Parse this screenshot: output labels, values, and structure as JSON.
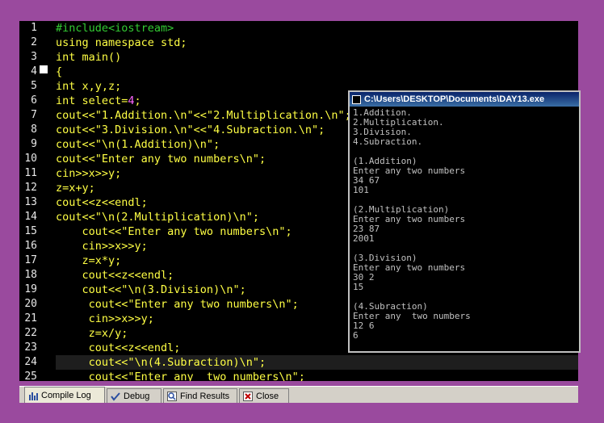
{
  "editor": {
    "line_numbers": [
      "1",
      "2",
      "3",
      "4",
      "5",
      "6",
      "7",
      "8",
      "9",
      "10",
      "11",
      "12",
      "13",
      "14",
      "15",
      "16",
      "17",
      "18",
      "19",
      "20",
      "21",
      "22",
      "23",
      "24",
      "25"
    ],
    "lines": [
      [
        {
          "t": "#include<iostream>",
          "c": "pp"
        }
      ],
      [
        {
          "t": "using namespace std;",
          "c": "kw"
        }
      ],
      [
        {
          "t": "int main()",
          "c": "kw"
        }
      ],
      [
        {
          "t": "{",
          "c": "kw"
        }
      ],
      [
        {
          "t": "int x,y,z;",
          "c": "kw"
        }
      ],
      [
        {
          "t": "int select=",
          "c": "kw"
        },
        {
          "t": "4",
          "c": "num"
        },
        {
          "t": ";",
          "c": "kw"
        }
      ],
      [
        {
          "t": "cout<<\"1.Addition.\\n\"<<\"2.Multiplication.\\n\";",
          "c": "kw"
        }
      ],
      [
        {
          "t": "cout<<\"3.Division.\\n\"<<\"4.Subraction.\\n\";",
          "c": "kw"
        }
      ],
      [
        {
          "t": "cout<<\"\\n(1.Addition)\\n\";",
          "c": "kw"
        }
      ],
      [
        {
          "t": "cout<<\"Enter any two numbers\\n\";",
          "c": "kw"
        }
      ],
      [
        {
          "t": "cin>>x>>y;",
          "c": "kw"
        }
      ],
      [
        {
          "t": "z=x+y;",
          "c": "kw"
        }
      ],
      [
        {
          "t": "cout<<z<<endl;",
          "c": "kw"
        }
      ],
      [
        {
          "t": "cout<<\"\\n(2.Multiplication)\\n\";",
          "c": "kw"
        }
      ],
      [
        {
          "t": "    cout<<\"Enter any two numbers\\n\";",
          "c": "kw"
        }
      ],
      [
        {
          "t": "    cin>>x>>y;",
          "c": "kw"
        }
      ],
      [
        {
          "t": "    z=x*y;",
          "c": "kw"
        }
      ],
      [
        {
          "t": "    cout<<z<<endl;",
          "c": "kw"
        }
      ],
      [
        {
          "t": "    cout<<\"\\n(3.Division)\\n\";",
          "c": "kw"
        }
      ],
      [
        {
          "t": "     cout<<\"Enter any two numbers\\n\";",
          "c": "kw"
        }
      ],
      [
        {
          "t": "     cin>>x>>y;",
          "c": "kw"
        }
      ],
      [
        {
          "t": "     z=x/y;",
          "c": "kw"
        }
      ],
      [
        {
          "t": "     cout<<z<<endl;",
          "c": "kw"
        }
      ],
      [
        {
          "t": "     cout<<\"\\n(4.Subraction)\\n\";",
          "c": "kw"
        }
      ],
      [
        {
          "t": "     cout<<\"Enter any  two numbers\\n\";",
          "c": "kw"
        }
      ]
    ],
    "active_line": "24"
  },
  "console": {
    "title": "C:\\Users\\DESKTOP\\Documents\\DAY13.exe",
    "lines": [
      "1.Addition.",
      "2.Multiplication.",
      "3.Division.",
      "4.Subraction.",
      "",
      "(1.Addition)",
      "Enter any two numbers",
      "34 67",
      "101",
      "",
      "(2.Multiplication)",
      "Enter any two numbers",
      "23 87",
      "2001",
      "",
      "(3.Division)",
      "Enter any two numbers",
      "30 2",
      "15",
      "",
      "(4.Subraction)",
      "Enter any  two numbers",
      "12 6",
      "6"
    ]
  },
  "tabs": [
    {
      "label": "Compile Log",
      "icon": "chart-icon"
    },
    {
      "label": "Debug",
      "icon": "check-icon"
    },
    {
      "label": "Find Results",
      "icon": "find-icon"
    },
    {
      "label": "Close",
      "icon": "close-icon"
    }
  ]
}
